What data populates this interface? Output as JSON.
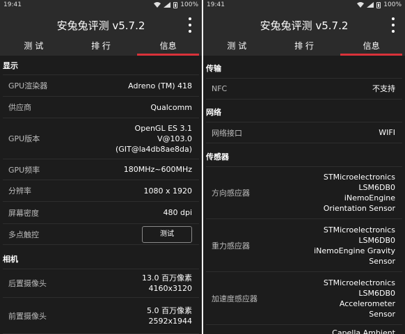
{
  "status_bar": {
    "time": "19:41",
    "battery": "100%"
  },
  "app": {
    "title": "安兔兔评测 v5.7.2"
  },
  "tabs": [
    "测 试",
    "排 行",
    "信息"
  ],
  "left": {
    "display_section": "显示",
    "display_rows": [
      {
        "label": "GPU渲染器",
        "value": "Adreno (TM) 418"
      },
      {
        "label": "供应商",
        "value": "Qualcomm"
      },
      {
        "label": "GPU版本",
        "value_lines": [
          "OpenGL ES 3.1",
          "V@103.0",
          "(GIT@la4db8ae8da)"
        ]
      },
      {
        "label": "GPU频率",
        "value": "180MHz~600MHz"
      },
      {
        "label": "分辨率",
        "value": "1080 x 1920"
      },
      {
        "label": "屏幕密度",
        "value": "480 dpi"
      },
      {
        "label": "多点触控",
        "button": "测试"
      }
    ],
    "camera_section": "相机",
    "camera_rows": [
      {
        "label": "后置摄像头",
        "value_lines": [
          "13.0 百万像素",
          "4160x3120"
        ]
      },
      {
        "label": "前置摄像头",
        "value_lines": [
          "5.0 百万像素",
          "2592x1944"
        ]
      }
    ]
  },
  "right": {
    "transfer_section": "传输",
    "nfc": {
      "label": "NFC",
      "value": "不支持"
    },
    "network_section": "网络",
    "network": {
      "label": "网络接口",
      "value": "WIFI"
    },
    "sensor_section": "传感器",
    "sensors": [
      {
        "label": "方向感应器",
        "value_lines": [
          "STMicroelectronics",
          "LSM6DB0",
          "iNemoEngine",
          "Orientation Sensor"
        ]
      },
      {
        "label": "重力感应器",
        "value_lines": [
          "STMicroelectronics",
          "LSM6DB0",
          "iNemoEngine Gravity",
          "Sensor"
        ]
      },
      {
        "label": "加速度感应器",
        "value_lines": [
          "STMicroelectronics",
          "LSM6DB0",
          "Accelerometer",
          "Sensor"
        ]
      },
      {
        "label": "",
        "value_lines": [
          "Capella Ambient"
        ]
      }
    ]
  },
  "icons": [
    "wifi-icon",
    "signal-icon",
    "battery-icon",
    "more-vert-icon"
  ],
  "colors": {
    "background": "#1c1c1c",
    "header": "#2b2b2b",
    "accent": "#d9323a"
  }
}
